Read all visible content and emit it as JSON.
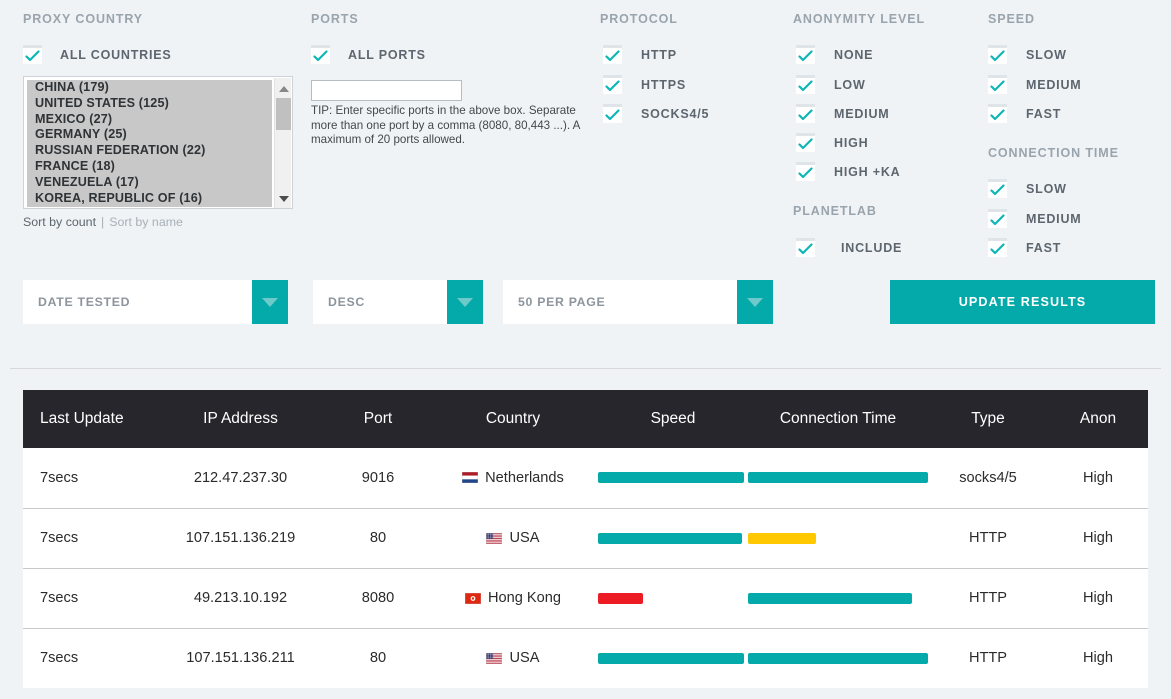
{
  "colors": {
    "teal": "#04a9a9",
    "yellow": "#ffc800",
    "red": "#ed1c24",
    "track": "#eef2f5",
    "header_bg": "#26262c",
    "page_bg": "#eff3f6"
  },
  "filters": {
    "proxy_country": {
      "title": "PROXY COUNTRY",
      "all_checkbox": {
        "label": "ALL COUNTRIES",
        "checked": true
      },
      "countries": [
        {
          "name": "CHINA",
          "count": "(179)"
        },
        {
          "name": "UNITED STATES",
          "count": "(125)"
        },
        {
          "name": "MEXICO",
          "count": "(27)"
        },
        {
          "name": "GERMANY",
          "count": "(25)"
        },
        {
          "name": "RUSSIAN FEDERATION",
          "count": "(22)"
        },
        {
          "name": "FRANCE",
          "count": "(18)"
        },
        {
          "name": "VENEZUELA",
          "count": "(17)"
        },
        {
          "name": "KOREA, REPUBLIC OF",
          "count": "(16)"
        }
      ],
      "sort_by_count": "Sort by count",
      "sort_separator": "|",
      "sort_by_name": "Sort by name"
    },
    "ports": {
      "title": "PORTS",
      "all_checkbox": {
        "label": "ALL PORTS",
        "checked": true
      },
      "input_value": "",
      "input_placeholder": "",
      "tip": "TIP: Enter specific ports in the above box. Separate more than one port by a comma (8080, 80,443 ...). A maximum of 20 ports allowed."
    },
    "protocol": {
      "title": "PROTOCOL",
      "options": [
        {
          "label": "HTTP",
          "checked": true
        },
        {
          "label": "HTTPS",
          "checked": true
        },
        {
          "label": "SOCKS4/5",
          "checked": true
        }
      ]
    },
    "anonymity": {
      "title": "ANONYMITY LEVEL",
      "options": [
        {
          "label": "NONE",
          "checked": true
        },
        {
          "label": "LOW",
          "checked": true
        },
        {
          "label": "MEDIUM",
          "checked": true
        },
        {
          "label": "HIGH",
          "checked": true
        },
        {
          "label": "HIGH +KA",
          "checked": true
        }
      ]
    },
    "planetlab": {
      "title": "PLANETLAB",
      "options": [
        {
          "label": "INCLUDE",
          "checked": true
        }
      ]
    },
    "speed": {
      "title": "SPEED",
      "options": [
        {
          "label": "SLOW",
          "checked": true
        },
        {
          "label": "MEDIUM",
          "checked": true
        },
        {
          "label": "FAST",
          "checked": true
        }
      ]
    },
    "connection_time": {
      "title": "CONNECTION TIME",
      "options": [
        {
          "label": "SLOW",
          "checked": true
        },
        {
          "label": "MEDIUM",
          "checked": true
        },
        {
          "label": "FAST",
          "checked": true
        }
      ]
    }
  },
  "controls": {
    "sort_field": "DATE TESTED",
    "sort_direction": "DESC",
    "per_page": "50 PER PAGE",
    "update_button": "UPDATE RESULTS"
  },
  "table": {
    "columns": [
      "Last Update",
      "IP Address",
      "Port",
      "Country",
      "Speed",
      "Connection Time",
      "Type",
      "Anon"
    ],
    "rows": [
      {
        "last_update": "7secs",
        "ip": "212.47.237.30",
        "port": "9016",
        "country": "Netherlands",
        "flag": "nl",
        "speed_pct": 97,
        "speed_color": "#04a9a9",
        "conn_pct": 100,
        "conn_color": "#04a9a9",
        "type": "socks4/5",
        "anon": "High"
      },
      {
        "last_update": "7secs",
        "ip": "107.151.136.219",
        "port": "80",
        "country": "USA",
        "flag": "us",
        "speed_pct": 96,
        "speed_color": "#04a9a9",
        "conn_pct": 38,
        "conn_color": "#ffc800",
        "type": "HTTP",
        "anon": "High"
      },
      {
        "last_update": "7secs",
        "ip": "49.213.10.192",
        "port": "8080",
        "country": "Hong Kong",
        "flag": "hk",
        "speed_pct": 30,
        "speed_color": "#ed1c24",
        "conn_pct": 91,
        "conn_color": "#04a9a9",
        "type": "HTTP",
        "anon": "High"
      },
      {
        "last_update": "7secs",
        "ip": "107.151.136.211",
        "port": "80",
        "country": "USA",
        "flag": "us",
        "speed_pct": 97,
        "speed_color": "#04a9a9",
        "conn_pct": 100,
        "conn_color": "#04a9a9",
        "type": "HTTP",
        "anon": "High"
      }
    ]
  }
}
